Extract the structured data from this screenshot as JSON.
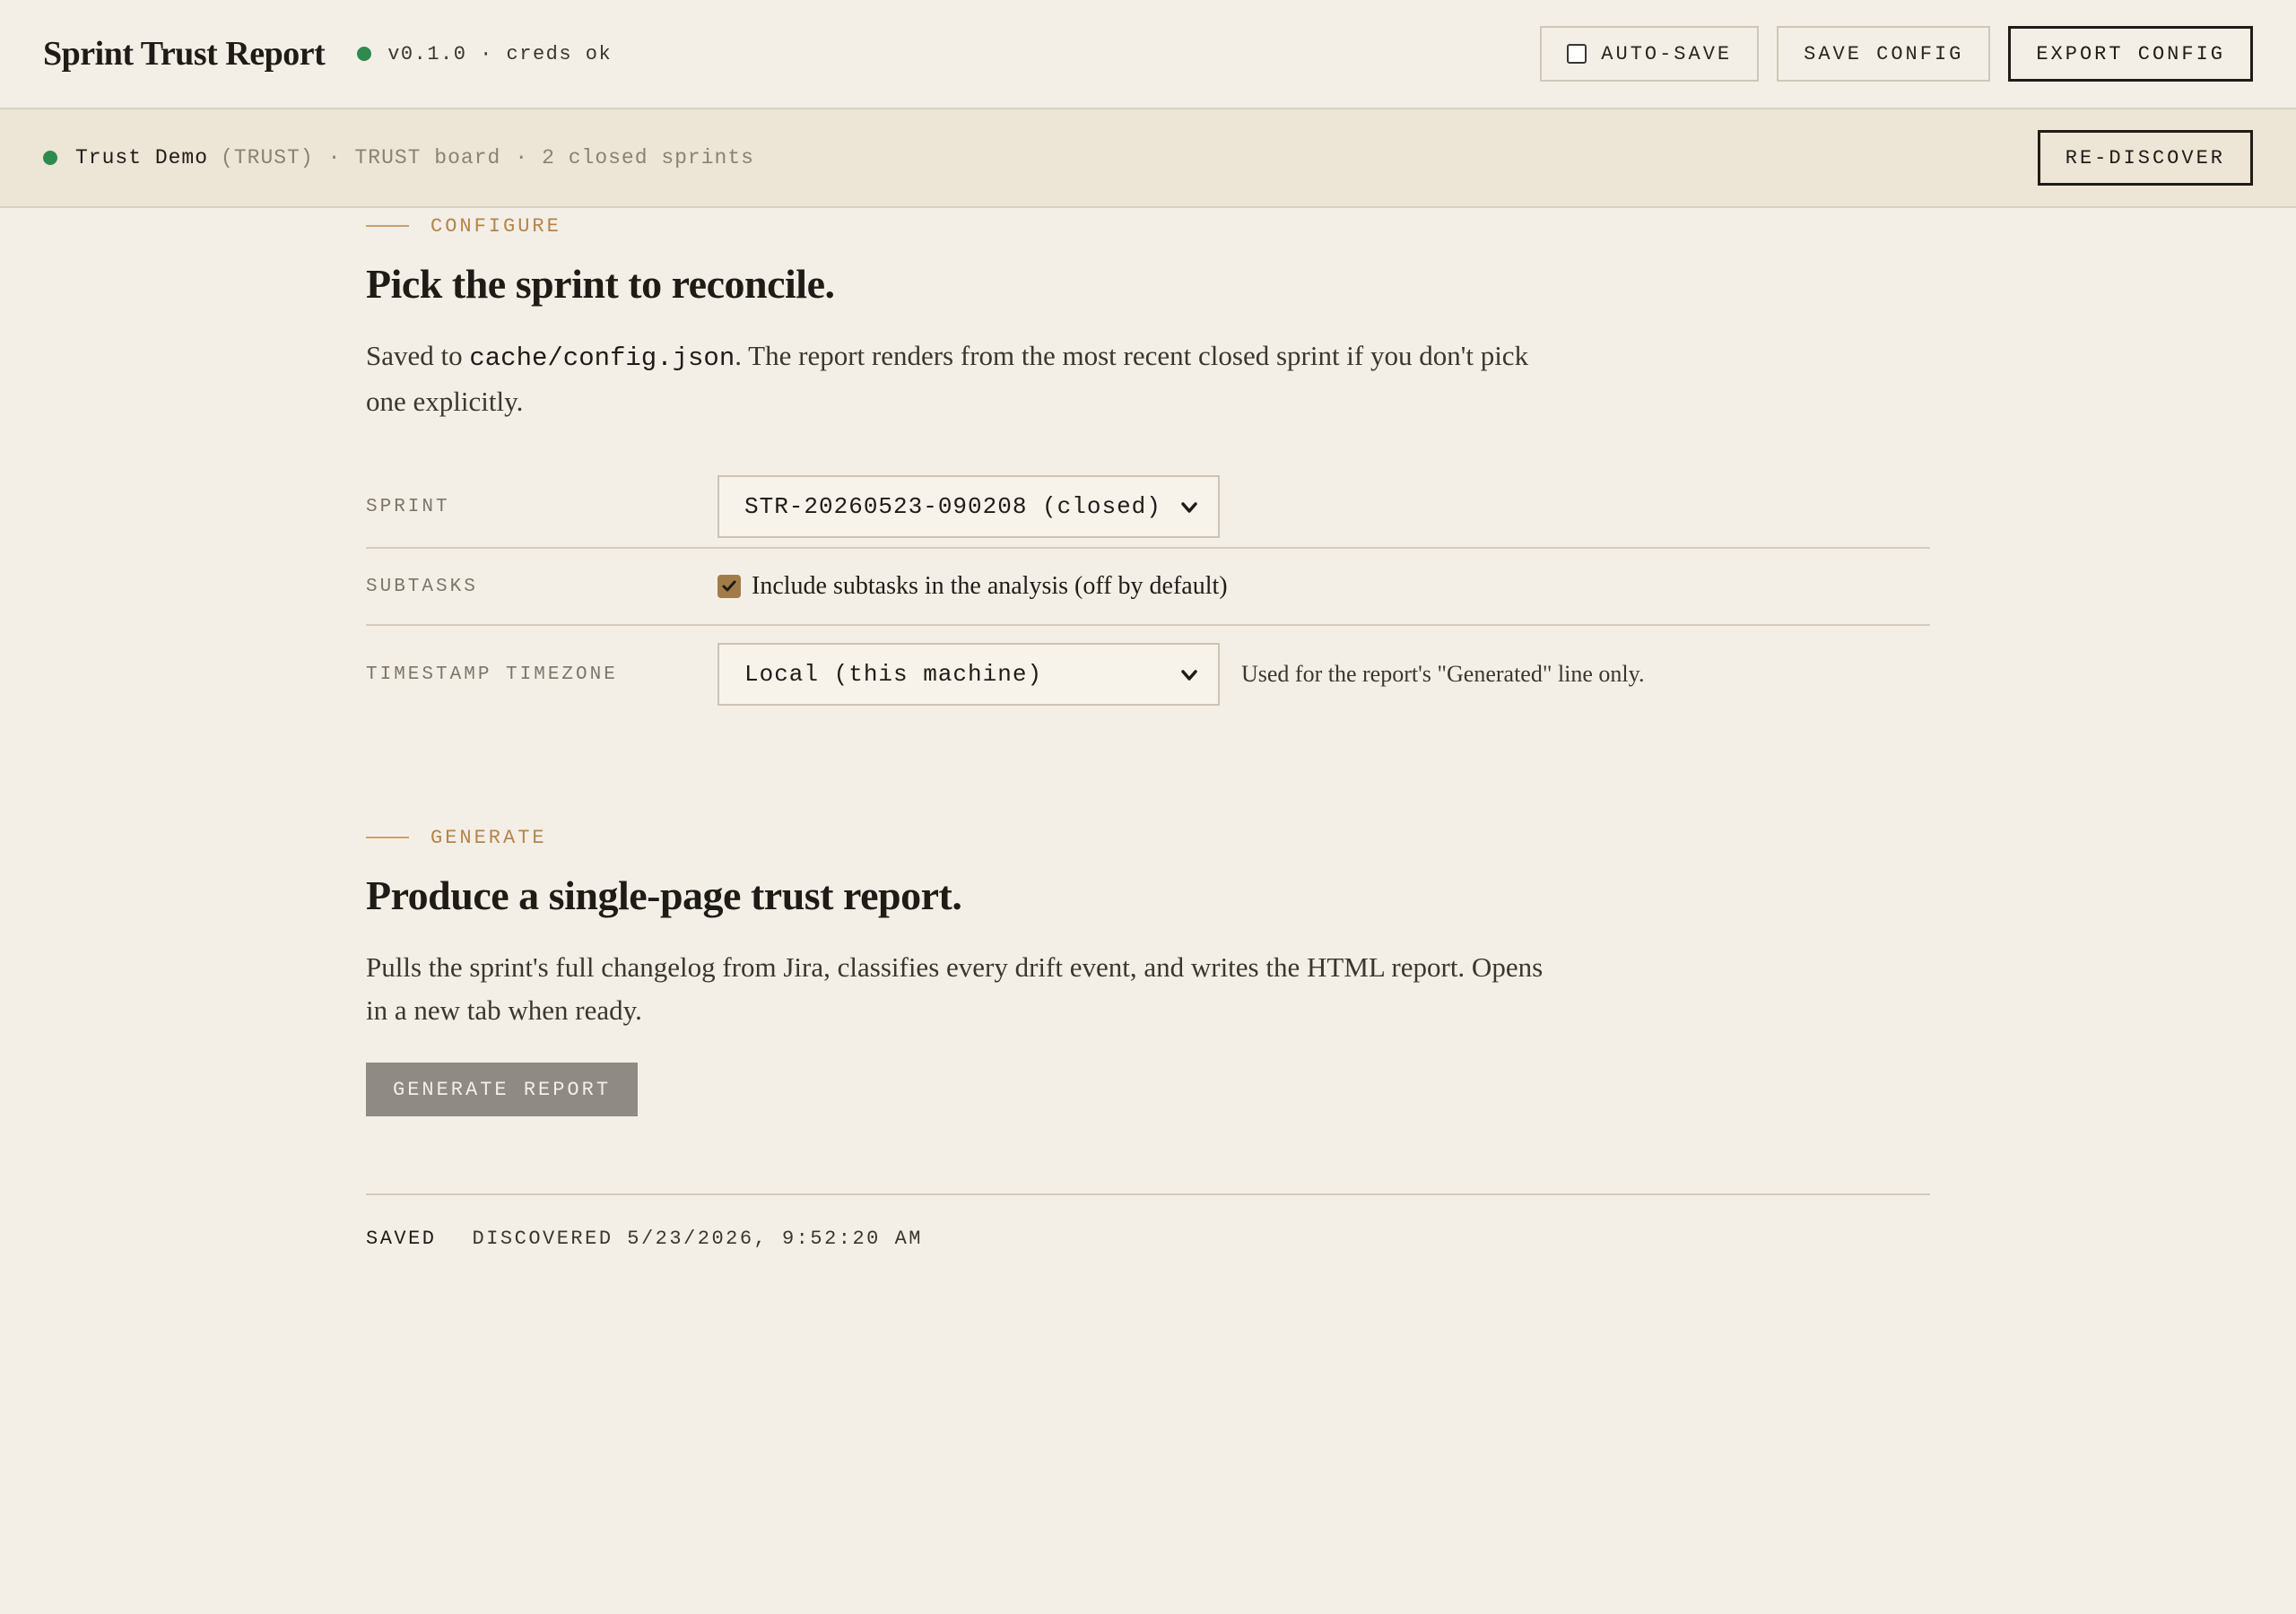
{
  "header": {
    "title": "Sprint Trust Report",
    "meta": "v0.1.0 · creds ok",
    "auto_save_label": "AUTO-SAVE",
    "save_config_label": "SAVE CONFIG",
    "export_config_label": "EXPORT CONFIG"
  },
  "project": {
    "name": "Trust Demo",
    "key": "(TRUST)",
    "board": "TRUST board",
    "sprints": "2 closed sprints",
    "separator": "·",
    "rediscover_label": "RE-DISCOVER"
  },
  "configure": {
    "section_label": "CONFIGURE",
    "heading": "Pick the sprint to reconcile.",
    "desc_prefix": "Saved to",
    "desc_code": "cache/config.json",
    "desc_suffix": ". The report renders from the most recent closed sprint if you don't pick one explicitly.",
    "sprint_label": "SPRINT",
    "sprint_value": "STR-20260523-090208 (closed)",
    "subtasks_label": "SUBTASKS",
    "subtasks_text": "Include subtasks in the analysis (off by default)",
    "subtasks_checked": true,
    "timezone_label": "TIMESTAMP TIMEZONE",
    "timezone_value": "Local (this machine)",
    "timezone_hint": "Used for the report's \"Generated\" line only."
  },
  "generate": {
    "section_label": "GENERATE",
    "heading": "Produce a single-page trust report.",
    "desc": "Pulls the sprint's full changelog from Jira, classifies every drift event, and writes the HTML report. Opens in a new tab when ready.",
    "button_label": "GENERATE REPORT"
  },
  "status": {
    "saved": "SAVED",
    "discovered": "DISCOVERED 5/23/2026, 9:52:20 AM"
  },
  "colors": {
    "background": "#f4efe6",
    "accent": "#b4844a",
    "status_ok": "#2f8a4f",
    "generate_button": "#8f8a84"
  },
  "icons": {
    "status": "status-dot-icon",
    "checkbox": "checkbox-icon",
    "chevron": "chevron-down-icon"
  }
}
